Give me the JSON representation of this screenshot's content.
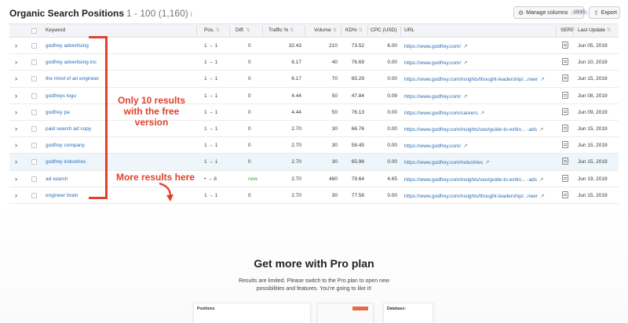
{
  "header": {
    "title": "Organic Search Positions",
    "range": "1 - 100 (1,160)",
    "info": "i",
    "manage_columns": "Manage columns",
    "manage_badge": "10/15",
    "export": "Export"
  },
  "table": {
    "columns": [
      "Keyword",
      "Pos.",
      "Diff.",
      "Traffic %",
      "Volume",
      "KD%",
      "CPC (USD)",
      "URL",
      "SERP",
      "Last Update"
    ],
    "rows": [
      {
        "keyword": "godfrey advertising",
        "pos": "1 → 1",
        "diff": "0",
        "traffic": "32.43",
        "volume": "210",
        "kd": "73.52",
        "cpc": "6.00",
        "url": "https://www.godfrey.com/",
        "last_update": "Jun 05, 2019"
      },
      {
        "keyword": "godfrey advertising inc",
        "pos": "1 → 1",
        "diff": "0",
        "traffic": "6.17",
        "volume": "40",
        "kd": "76.69",
        "cpc": "0.00",
        "url": "https://www.godfrey.com/",
        "last_update": "Jun 10, 2019"
      },
      {
        "keyword": "the mind of an engineer",
        "pos": "1 → 1",
        "diff": "0",
        "traffic": "6.17",
        "volume": "70",
        "kd": "65.29",
        "cpc": "0.00",
        "url": "https://www.godfrey.com/insights/thought-leadership/...neer",
        "last_update": "Jun 15, 2019"
      },
      {
        "keyword": "godfreys logo",
        "pos": "1 → 1",
        "diff": "0",
        "traffic": "4.44",
        "volume": "50",
        "kd": "47.84",
        "cpc": "0.09",
        "url": "https://www.godfrey.com/",
        "last_update": "Jun 08, 2019"
      },
      {
        "keyword": "godfrey pa",
        "pos": "1 → 1",
        "diff": "0",
        "traffic": "4.44",
        "volume": "50",
        "kd": "76.13",
        "cpc": "0.00",
        "url": "https://www.godfrey.com/careers",
        "last_update": "Jun 09, 2019"
      },
      {
        "keyword": "paid search ad copy",
        "pos": "1 → 1",
        "diff": "0",
        "traffic": "2.70",
        "volume": "30",
        "kd": "66.76",
        "cpc": "0.00",
        "url": "https://www.godfrey.com/insights/seo/guide-to-writin... -ads",
        "last_update": "Jun 15, 2019"
      },
      {
        "keyword": "godfrey company",
        "pos": "1 → 1",
        "diff": "0",
        "traffic": "2.70",
        "volume": "30",
        "kd": "58.45",
        "cpc": "0.00",
        "url": "https://www.godfrey.com/",
        "last_update": "Jun 15, 2019"
      },
      {
        "keyword": "godfrey industries",
        "pos": "1 → 1",
        "diff": "0",
        "traffic": "2.70",
        "volume": "30",
        "kd": "65.96",
        "cpc": "0.00",
        "url": "https://www.godfrey.com/industries",
        "last_update": "Jun 15, 2019"
      },
      {
        "keyword": "ad search",
        "pos": "• → 8",
        "diff": "new",
        "traffic": "2.70",
        "volume": "480",
        "kd": "79.64",
        "cpc": "4.65",
        "url": "https://www.godfrey.com/insights/seo/guide-to-writin... -ads",
        "last_update": "Jun 19, 2019"
      },
      {
        "keyword": "engineer brain",
        "pos": "1 → 1",
        "diff": "0",
        "traffic": "2.70",
        "volume": "30",
        "kd": "77.56",
        "cpc": "0.00",
        "url": "https://www.godfrey.com/insights/thought-leadership/...neer",
        "last_update": "Jun 15, 2019"
      }
    ]
  },
  "annotations": {
    "free_version": "Only 10 results with the free version",
    "more_results": "More results here",
    "color": "#e1412b"
  },
  "pro": {
    "title": "Get more with Pro plan",
    "description": "Results are limited. Please switch to the Pro plan to open new possibilities and features. You're going to like it!",
    "preview_positions": "Positions",
    "preview_database": "Database:"
  }
}
